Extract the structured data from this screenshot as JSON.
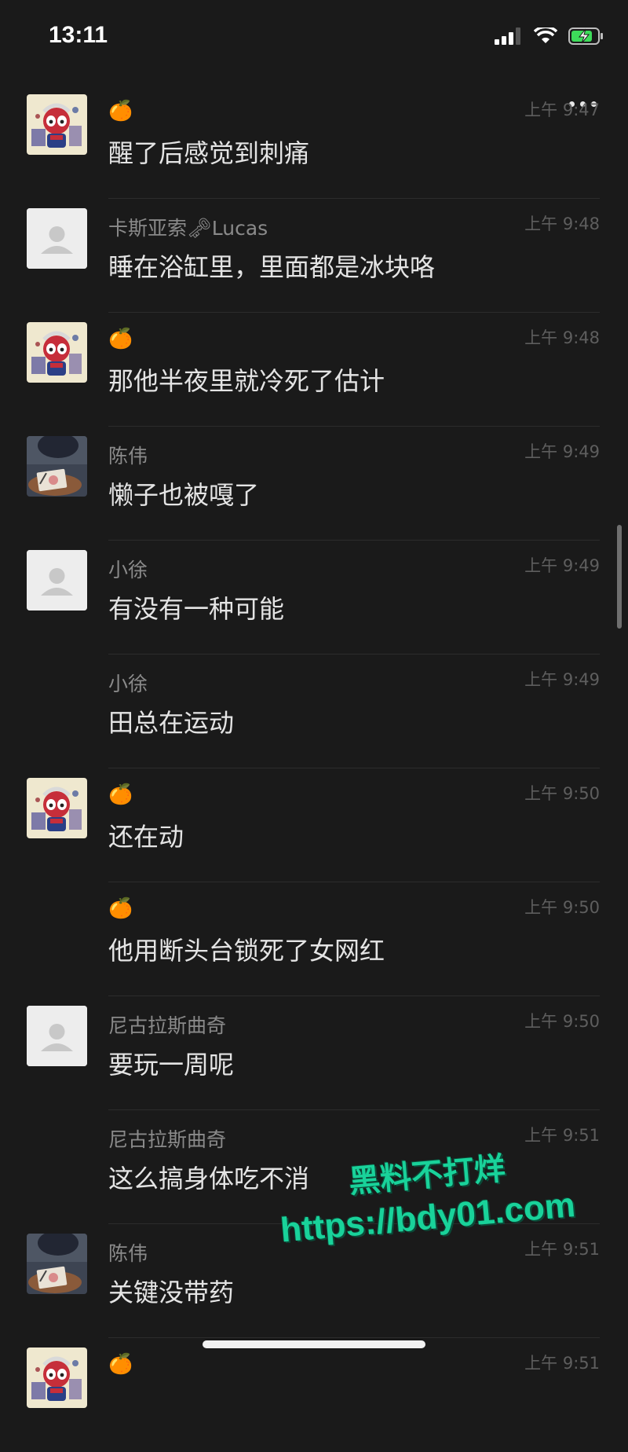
{
  "status_bar": {
    "time": "13:11"
  },
  "messages": [
    {
      "sender": "🍊",
      "sender_is_emoji": true,
      "time": "上午 9:47",
      "text": "醒了后感觉到刺痛",
      "avatar": "cartoon"
    },
    {
      "sender": "卡斯亚索🗝Lucas",
      "sender_is_emoji": false,
      "time": "上午 9:48",
      "text": "睡在浴缸里，里面都是冰块咯",
      "avatar": "placeholder"
    },
    {
      "sender": "🍊",
      "sender_is_emoji": true,
      "time": "上午 9:48",
      "text": "那他半夜里就冷死了估计",
      "avatar": "cartoon"
    },
    {
      "sender": "陈伟",
      "sender_is_emoji": false,
      "time": "上午 9:49",
      "text": "懒子也被嘎了",
      "avatar": "photo"
    },
    {
      "sender": "小徐",
      "sender_is_emoji": false,
      "time": "上午 9:49",
      "text": "有没有一种可能",
      "avatar": "placeholder"
    },
    {
      "sender": "小徐",
      "sender_is_emoji": false,
      "time": "上午 9:49",
      "text": "田总在运动",
      "avatar": "none"
    },
    {
      "sender": "🍊",
      "sender_is_emoji": true,
      "time": "上午 9:50",
      "text": "还在动",
      "avatar": "cartoon"
    },
    {
      "sender": "🍊",
      "sender_is_emoji": true,
      "time": "上午 9:50",
      "text": "他用断头台锁死了女网红",
      "avatar": "none"
    },
    {
      "sender": "尼古拉斯曲奇",
      "sender_is_emoji": false,
      "time": "上午 9:50",
      "text": "要玩一周呢",
      "avatar": "placeholder"
    },
    {
      "sender": "尼古拉斯曲奇",
      "sender_is_emoji": false,
      "time": "上午 9:51",
      "text": "这么搞身体吃不消",
      "avatar": "none"
    },
    {
      "sender": "陈伟",
      "sender_is_emoji": false,
      "time": "上午 9:51",
      "text": "关键没带药",
      "avatar": "photo"
    },
    {
      "sender": "🍊",
      "sender_is_emoji": true,
      "time": "上午 9:51",
      "text": "",
      "avatar": "cartoon"
    }
  ],
  "watermark": {
    "title": "黑料不打烊",
    "url": "https://bdy01.com"
  },
  "colors": {
    "background": "#1a1a1a",
    "sender": "#8a8a8a",
    "time": "#5e5e5e",
    "text": "#e4e4e4",
    "watermark": "#19d29a"
  }
}
